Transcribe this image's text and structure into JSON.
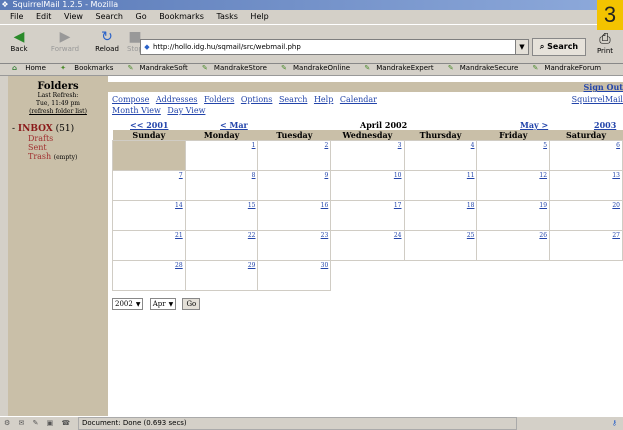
{
  "window": {
    "title": "SquirrelMail 1.2.5 - Mozilla",
    "page_number": "3"
  },
  "menubar": [
    "File",
    "Edit",
    "View",
    "Search",
    "Go",
    "Bookmarks",
    "Tasks",
    "Help"
  ],
  "navbar": {
    "back": "Back",
    "forward": "Forward",
    "reload": "Reload",
    "stop": "Stop",
    "url": "http://hollo.idg.hu/sqmail/src/webmail.php",
    "search": "Search",
    "print": "Print"
  },
  "personal_toolbar": [
    "Home",
    "Bookmarks",
    "MandrakeSoft",
    "MandrakeStore",
    "MandrakeOnline",
    "MandrakeExpert",
    "MandrakeSecure",
    "MandrakeForum"
  ],
  "sidebar": {
    "title": "Folders",
    "last_refresh_label": "Last Refresh:",
    "last_refresh_time": "Tue, 11:49 pm",
    "refresh_link": "(refresh folder list)",
    "inbox": "INBOX",
    "inbox_count": "(51)",
    "folders": [
      {
        "name": "Drafts",
        "note": ""
      },
      {
        "name": "Sent",
        "note": ""
      },
      {
        "name": "Trash",
        "note": "(empty)"
      }
    ]
  },
  "main": {
    "sign_out": "Sign Out",
    "squirrelmail_link": "SquirrelMail",
    "menu": [
      "Compose",
      "Addresses",
      "Folders",
      "Options",
      "Search",
      "Help",
      "Calendar"
    ],
    "views": [
      "Month View",
      "Day View"
    ]
  },
  "calendar": {
    "prev_year": "<< 2001",
    "prev_month": "< Mar",
    "title": "April 2002",
    "next_month": "May >",
    "next_year": "2003 >>",
    "weekdays": [
      "Sunday",
      "Monday",
      "Tuesday",
      "Wednesday",
      "Thursday",
      "Friday",
      "Saturday"
    ],
    "weeks": [
      [
        "",
        "1",
        "2",
        "3",
        "4",
        "5",
        "6"
      ],
      [
        "7",
        "8",
        "9",
        "10",
        "11",
        "12",
        "13"
      ],
      [
        "14",
        "15",
        "16",
        "17",
        "18",
        "19",
        "20"
      ],
      [
        "21",
        "22",
        "23",
        "24",
        "25",
        "26",
        "27"
      ],
      [
        "28",
        "29",
        "30",
        "",
        "",
        "",
        ""
      ]
    ],
    "year_select": "2002",
    "month_select": "Apr",
    "go": "Go"
  },
  "statusbar": {
    "message": "Document: Done (0.693 secs)"
  }
}
